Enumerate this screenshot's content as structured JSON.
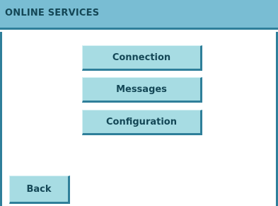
{
  "header": {
    "title": "ONLINE SERVICES"
  },
  "menu": {
    "items": [
      {
        "label": "Connection"
      },
      {
        "label": "Messages"
      },
      {
        "label": "Configuration"
      }
    ]
  },
  "footer": {
    "back_label": "Back"
  },
  "colors": {
    "header_bg": "#79bdd3",
    "header_text": "#144756",
    "button_bg": "#a7dce3",
    "button_shadow": "#2f7f9a"
  }
}
